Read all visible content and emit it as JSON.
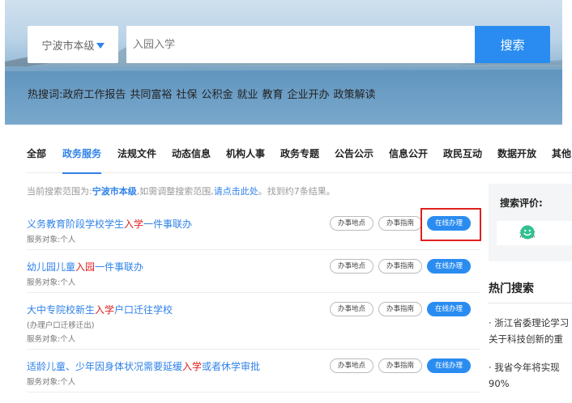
{
  "search": {
    "city": "宁波市本级",
    "placeholder": "入园入学",
    "button": "搜索"
  },
  "hot_words": {
    "label": "热搜词:",
    "items": [
      "政府工作报告",
      "共同富裕",
      "社保",
      "公积金",
      "就业",
      "教育",
      "企业开办",
      "政策解读"
    ]
  },
  "tabs": [
    {
      "label": "全部",
      "active": false
    },
    {
      "label": "政务服务",
      "active": true
    },
    {
      "label": "法规文件",
      "active": false
    },
    {
      "label": "动态信息",
      "active": false
    },
    {
      "label": "机构人事",
      "active": false
    },
    {
      "label": "政务专题",
      "active": false
    },
    {
      "label": "公告公示",
      "active": false
    },
    {
      "label": "信息公开",
      "active": false
    },
    {
      "label": "政民互动",
      "active": false
    },
    {
      "label": "数据开放",
      "active": false
    },
    {
      "label": "其他",
      "active": false
    }
  ],
  "scope": {
    "prefix": "当前搜索范围为:",
    "scope_name": "宁波市本级",
    "middle": ",如需调整搜索范围,",
    "link": "请点击此处",
    "suffix": "。找到约7条结果。"
  },
  "results": [
    {
      "title_parts": [
        "义务教育阶段学校学生",
        "入学",
        "一件事联办"
      ],
      "meta": [
        "服务对象:个人"
      ]
    },
    {
      "title_parts": [
        "幼儿园儿童",
        "入园",
        "一件事联办"
      ],
      "meta": [
        "服务对象:个人"
      ]
    },
    {
      "title_parts": [
        "大中专院校新生",
        "入学",
        "户口迁往学校"
      ],
      "meta": [
        "(办理户口迁移迁出)",
        "服务对象:个人"
      ]
    },
    {
      "title_parts": [
        "适龄儿童、少年因身体状况需要延缓",
        "入学",
        "或者休学审批"
      ],
      "meta": [
        "服务对象:个人"
      ]
    }
  ],
  "actions": {
    "location": "办事地点",
    "guide": "办事指南",
    "online": "在线办理"
  },
  "rating": {
    "title": "搜索评价:",
    "option": "满意"
  },
  "hot_search": {
    "title": "热门搜索",
    "items": [
      [
        "· 浙江省委理论学习",
        "关于科技创新的重"
      ],
      [
        "· 我省今年将实现",
        "90%"
      ]
    ]
  },
  "colors": {
    "accent": "#2a8cf0",
    "keyword": "#e02020",
    "highlight_border": "#e02020"
  }
}
